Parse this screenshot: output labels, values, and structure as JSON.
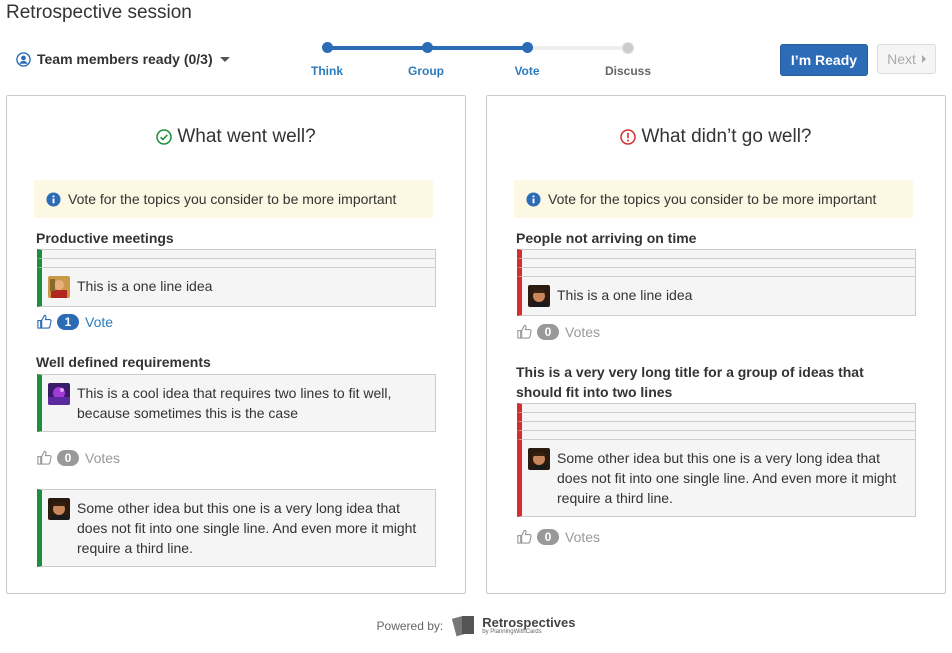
{
  "app": {
    "title": "Retrospective session"
  },
  "team": {
    "label": "Team members ready (0/3)"
  },
  "steps": [
    {
      "label": "Think",
      "active": true
    },
    {
      "label": "Group",
      "active": true
    },
    {
      "label": "Vote",
      "active": true
    },
    {
      "label": "Discuss",
      "active": false
    }
  ],
  "actions": {
    "ready_label": "I’m Ready",
    "next_label": "Next"
  },
  "left": {
    "title": "What went well?",
    "notice": "Vote for the topics you consider to be more important",
    "groups": [
      {
        "title": "Productive meetings",
        "idea": "This is a one line idea",
        "vote_count": "1",
        "vote_label": "Vote"
      },
      {
        "title": "Well defined requirements",
        "idea": "This is a cool idea that requires two lines to fit well, because sometimes this is the case",
        "vote_count": "0",
        "vote_label": "Votes"
      }
    ],
    "single": {
      "idea": "Some other idea but this one is a very long idea that does not fit into one single line. And even more it might require a third line."
    }
  },
  "right": {
    "title": "What didn’t go well?",
    "notice": "Vote for the topics you consider to be more important",
    "groups": [
      {
        "title": "People not arriving on time",
        "idea": "This is a one line idea",
        "vote_count": "0",
        "vote_label": "Votes"
      },
      {
        "title": "This is a very very long title for a group of ideas that should fit into two lines",
        "idea": "Some other idea but this one is a very long idea that does not fit into one single line. And even more it might require a third line.",
        "vote_count": "0",
        "vote_label": "Votes"
      }
    ]
  },
  "footer": {
    "powered": "Powered by:",
    "brand": "Retrospectives",
    "sub": "by PlanningWithCards"
  },
  "colors": {
    "accent": "#2c6bb6",
    "good": "#1e8e3e",
    "bad": "#d32f2f",
    "notice_bg": "#fcf8e3"
  }
}
